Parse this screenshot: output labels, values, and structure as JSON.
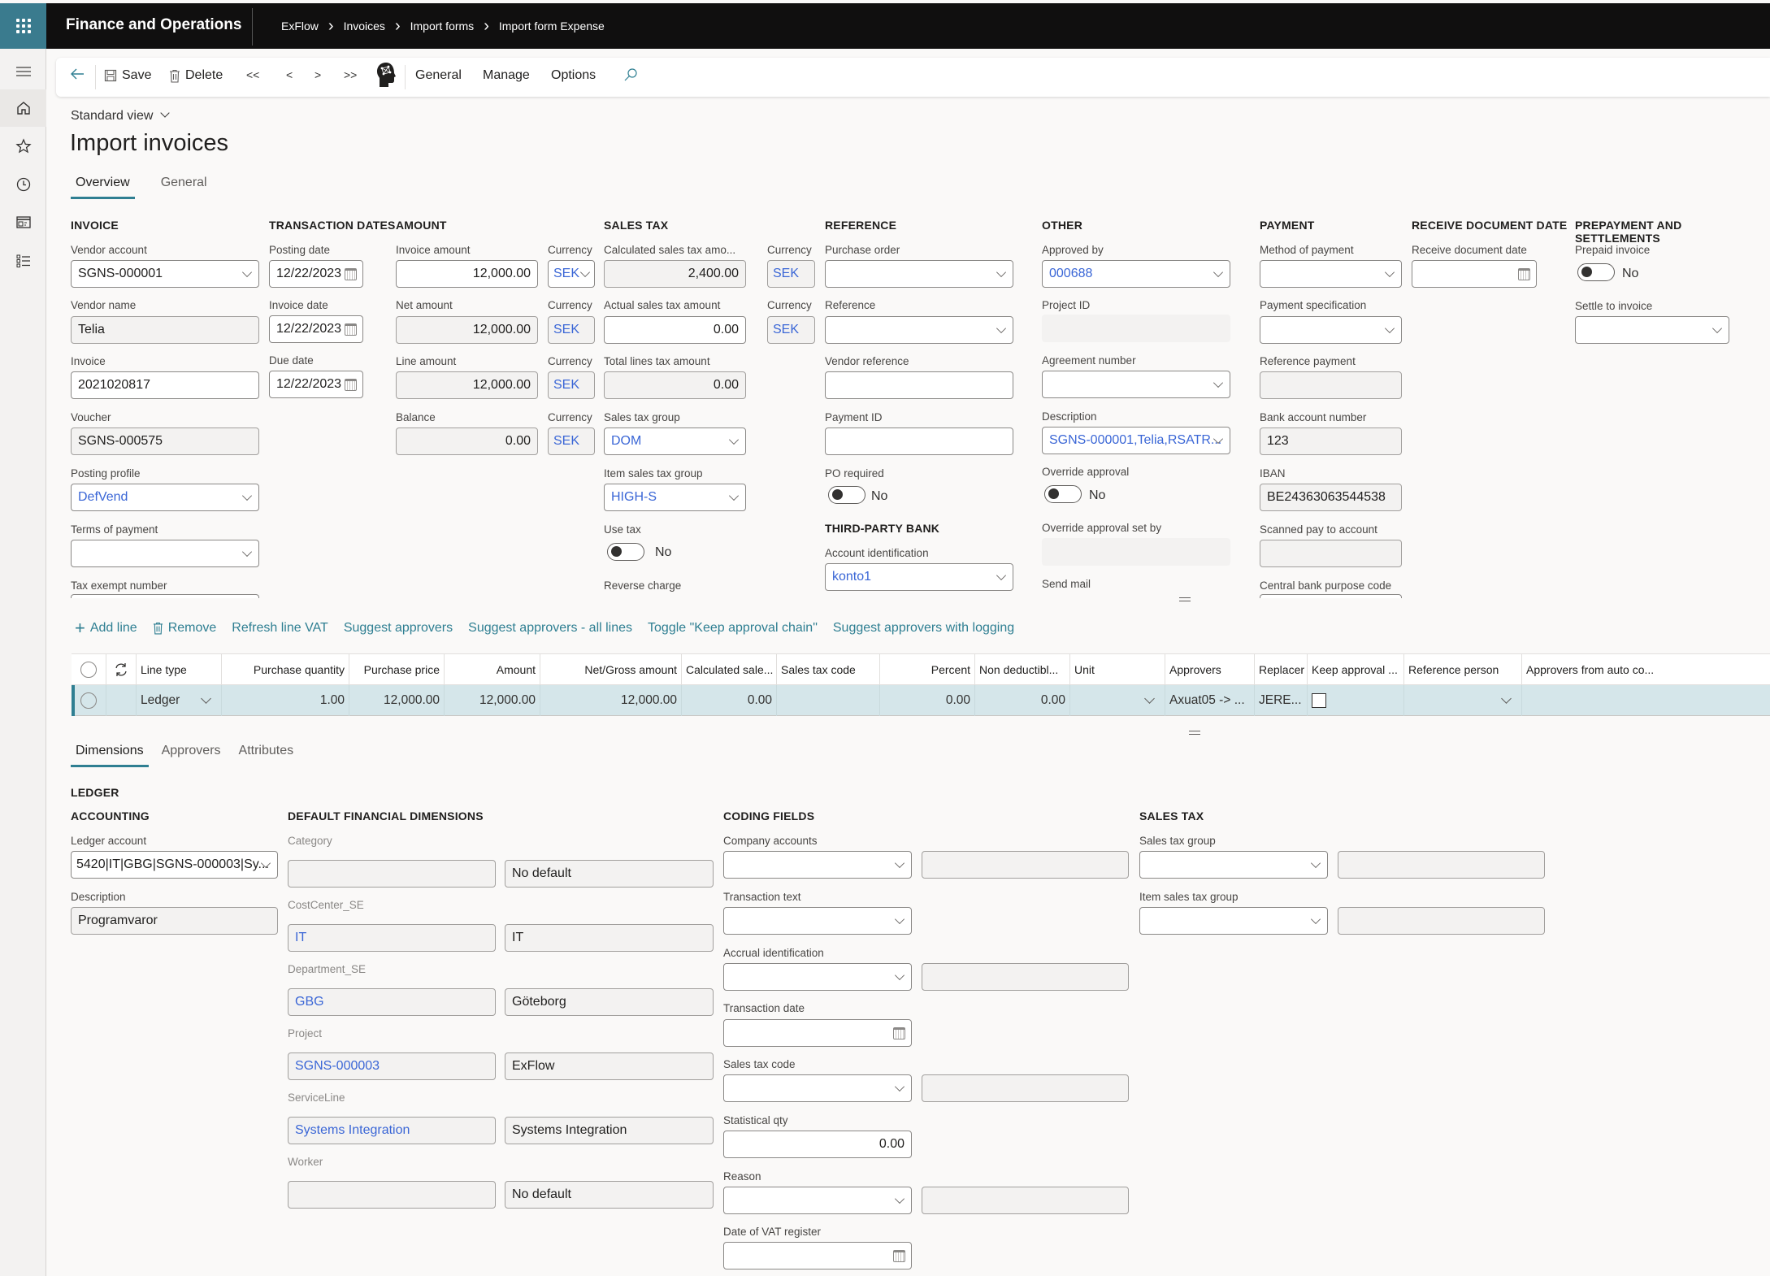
{
  "app": {
    "title": "Finance and Operations",
    "breadcrumb": [
      "ExFlow",
      "Invoices",
      "Import forms",
      "Import form Expense"
    ]
  },
  "toolbar": {
    "save": "Save",
    "delete": "Delete",
    "first": "<<",
    "prev": "<",
    "next": ">",
    "last": ">>",
    "general": "General",
    "manage": "Manage",
    "options": "Options"
  },
  "page": {
    "view": "Standard view",
    "title": "Import invoices",
    "tabs": [
      "Overview",
      "General"
    ]
  },
  "sections": {
    "invoice": "INVOICE",
    "transaction_dates": "TRANSACTION DATES",
    "amount": "AMOUNT",
    "sales_tax": "SALES TAX",
    "reference": "REFERENCE",
    "third_party_bank": "THIRD-PARTY BANK",
    "other": "OTHER",
    "payment": "PAYMENT",
    "receive_document_date": "RECEIVE DOCUMENT DATE",
    "prepayment": "PREPAYMENT AND SETTLEMENTS"
  },
  "invoice": {
    "vendor_account": {
      "label": "Vendor account",
      "value": "SGNS-000001"
    },
    "vendor_name": {
      "label": "Vendor name",
      "value": "Telia"
    },
    "invoice": {
      "label": "Invoice",
      "value": "2021020817"
    },
    "voucher": {
      "label": "Voucher",
      "value": "SGNS-000575"
    },
    "posting_profile": {
      "label": "Posting profile",
      "value": "DefVend"
    },
    "terms_of_payment": {
      "label": "Terms of payment",
      "value": ""
    },
    "tax_exempt_number": {
      "label": "Tax exempt number",
      "value": ""
    }
  },
  "dates": {
    "posting_date": {
      "label": "Posting date",
      "value": "12/22/2023"
    },
    "invoice_date": {
      "label": "Invoice date",
      "value": "12/22/2023"
    },
    "due_date": {
      "label": "Due date",
      "value": "12/22/2023"
    }
  },
  "amount": {
    "currency_label": "Currency",
    "invoice_amount": {
      "label": "Invoice amount",
      "value": "12,000.00",
      "currency": "SEK"
    },
    "net_amount": {
      "label": "Net amount",
      "value": "12,000.00",
      "currency": "SEK"
    },
    "line_amount": {
      "label": "Line amount",
      "value": "12,000.00",
      "currency": "SEK"
    },
    "balance": {
      "label": "Balance",
      "value": "0.00",
      "currency": "SEK"
    }
  },
  "sales_tax": {
    "calculated": {
      "label": "Calculated sales tax amo...",
      "value": "2,400.00",
      "currency": "SEK"
    },
    "actual": {
      "label": "Actual sales tax amount",
      "value": "0.00",
      "currency": "SEK"
    },
    "total_lines": {
      "label": "Total lines tax amount",
      "value": "0.00"
    },
    "sales_tax_group": {
      "label": "Sales tax group",
      "value": "DOM"
    },
    "item_sales_tax_group": {
      "label": "Item sales tax group",
      "value": "HIGH-S"
    },
    "use_tax": {
      "label": "Use tax",
      "value": "No"
    },
    "reverse_charge": {
      "label": "Reverse charge"
    }
  },
  "reference": {
    "purchase_order": {
      "label": "Purchase order",
      "value": ""
    },
    "reference": {
      "label": "Reference",
      "value": ""
    },
    "vendor_reference": {
      "label": "Vendor reference",
      "value": ""
    },
    "payment_id": {
      "label": "Payment ID",
      "value": ""
    },
    "po_required": {
      "label": "PO required",
      "value": "No"
    },
    "account_identification": {
      "label": "Account identification",
      "value": "konto1"
    }
  },
  "other": {
    "approved_by": {
      "label": "Approved by",
      "value": "000688"
    },
    "project_id": {
      "label": "Project ID",
      "value": ""
    },
    "agreement_number": {
      "label": "Agreement number",
      "value": ""
    },
    "description": {
      "label": "Description",
      "value": "SGNS-000001,Telia,RSATR..."
    },
    "override_approval": {
      "label": "Override approval",
      "value": "No"
    },
    "override_approval_set_by": {
      "label": "Override approval set by",
      "value": ""
    },
    "send_mail": {
      "label": "Send mail"
    }
  },
  "payment": {
    "method_of_payment": {
      "label": "Method of payment",
      "value": ""
    },
    "payment_specification": {
      "label": "Payment specification",
      "value": ""
    },
    "reference_payment": {
      "label": "Reference payment",
      "value": ""
    },
    "bank_account_number": {
      "label": "Bank account number",
      "value": "123"
    },
    "iban": {
      "label": "IBAN",
      "value": "BE24363063544538"
    },
    "scanned_pay_to_account": {
      "label": "Scanned pay to account",
      "value": ""
    },
    "central_bank_purpose_code": {
      "label": "Central bank purpose code",
      "value": ""
    }
  },
  "receive": {
    "receive_document_date": {
      "label": "Receive document date",
      "value": ""
    }
  },
  "prepayment": {
    "prepaid_invoice": {
      "label": "Prepaid invoice",
      "value": "No"
    },
    "settle_to_invoice": {
      "label": "Settle to invoice",
      "value": ""
    }
  },
  "actions": [
    "Add line",
    "Remove",
    "Refresh line VAT",
    "Suggest approvers",
    "Suggest approvers - all lines",
    "Toggle \"Keep approval chain\"",
    "Suggest approvers with logging"
  ],
  "grid": {
    "columns": [
      "Line type",
      "Purchase quantity",
      "Purchase price",
      "Amount",
      "Net/Gross amount",
      "Calculated sale...",
      "Sales tax code",
      "Percent",
      "Non deductibl...",
      "Unit",
      "Approvers",
      "Replacer",
      "Keep approval ...",
      "Reference person",
      "Approvers from auto co..."
    ],
    "rows": [
      {
        "line_type": "Ledger",
        "purchase_quantity": "1.00",
        "purchase_price": "12,000.00",
        "amount": "12,000.00",
        "net_gross_amount": "12,000.00",
        "calculated_sales_tax": "0.00",
        "sales_tax_code": "",
        "percent": "0.00",
        "non_deductible": "0.00",
        "unit": "",
        "approvers": "Axuat05 -> ...",
        "replacer": "JERE...",
        "keep_approval": false,
        "reference_person": "",
        "approvers_auto": ""
      }
    ]
  },
  "line_tabs": [
    "Dimensions",
    "Approvers",
    "Attributes"
  ],
  "ledger": {
    "title": "LEDGER",
    "accounting": "ACCOUNTING",
    "ledger_account": {
      "label": "Ledger account",
      "value": "5420|IT|GBG|SGNS-000003|Sy..."
    },
    "description": {
      "label": "Description",
      "value": "Programvaror"
    }
  },
  "dimensions": {
    "title": "DEFAULT FINANCIAL DIMENSIONS",
    "items": [
      {
        "label": "Category",
        "value": "",
        "desc": "No default"
      },
      {
        "label": "CostCenter_SE",
        "value": "IT",
        "desc": "IT"
      },
      {
        "label": "Department_SE",
        "value": "GBG",
        "desc": "Göteborg"
      },
      {
        "label": "Project",
        "value": "SGNS-000003",
        "desc": "ExFlow"
      },
      {
        "label": "ServiceLine",
        "value": "Systems Integration",
        "desc": "Systems Integration"
      },
      {
        "label": "Worker",
        "value": "",
        "desc": "No default"
      }
    ]
  },
  "coding": {
    "title": "CODING FIELDS",
    "company_accounts": "Company accounts",
    "transaction_text": "Transaction text",
    "accrual_identification": "Accrual identification",
    "transaction_date": "Transaction date",
    "sales_tax_code": "Sales tax code",
    "statistical_qty": {
      "label": "Statistical qty",
      "value": "0.00"
    },
    "reason": "Reason",
    "date_of_vat_register": "Date of VAT register"
  },
  "line_sales_tax": {
    "title": "SALES TAX",
    "sales_tax_group": "Sales tax group",
    "item_sales_tax_group": "Item sales tax group"
  }
}
